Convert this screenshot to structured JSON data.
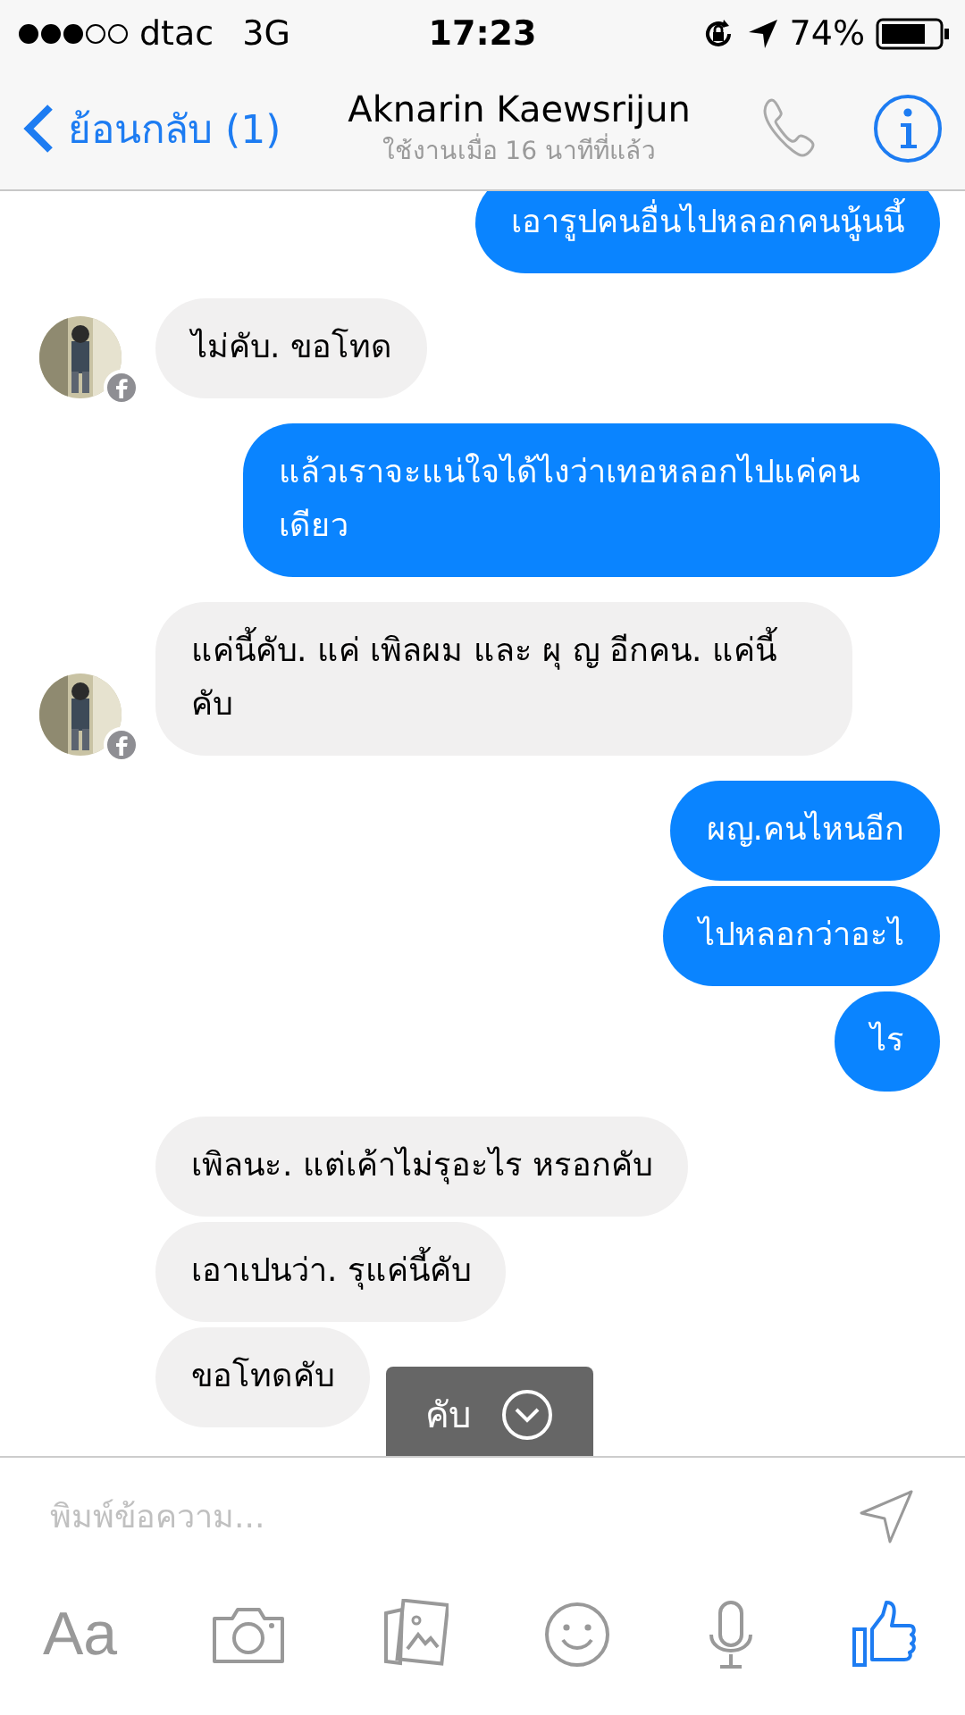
{
  "status_bar": {
    "carrier": "dtac",
    "network": "3G",
    "time": "17:23",
    "battery": "74%"
  },
  "nav": {
    "back": "ย้อนกลับ (1)",
    "title": "Aknarin Kaewsrijun",
    "subtitle": "ใช้งานเมื่อ 16 นาทีที่แล้ว"
  },
  "messages": [
    {
      "kind": "sent",
      "text": "เอารูปคนอื่นไปหลอกคนนู้นนี้"
    },
    {
      "kind": "received",
      "text": "ไม่คับ.  ขอโทด",
      "avatar": true
    },
    {
      "kind": "sent",
      "text": "แล้วเราจะแน่ใจได้ไงว่าเทอหลอกไปแค่คนเดียว"
    },
    {
      "kind": "received",
      "text": "แค่นี้คับ. แค่ เพิลผม และ ผุ ญ อีกคน.   แค่นี้ คับ",
      "avatar": true
    },
    {
      "kind": "sent",
      "text": "ผญ.คนไหนอีก"
    },
    {
      "kind": "sent",
      "text": "ไปหลอกว่าอะไ"
    },
    {
      "kind": "sent",
      "text": "ไร"
    },
    {
      "kind": "received",
      "text": "เพิลนะ. แต่เค้าไม่รุอะไร หรอกคับ",
      "avatar": false
    },
    {
      "kind": "received",
      "text": "เอาเปนว่า. รุแค่นี้คับ",
      "avatar": false
    },
    {
      "kind": "received",
      "text": "ขอโทดคับ",
      "avatar": false
    }
  ],
  "new_message_toast": "คับ",
  "composer": {
    "placeholder": "พิมพ์ข้อความ..."
  },
  "toolbar": {
    "text_button": "Aa"
  }
}
